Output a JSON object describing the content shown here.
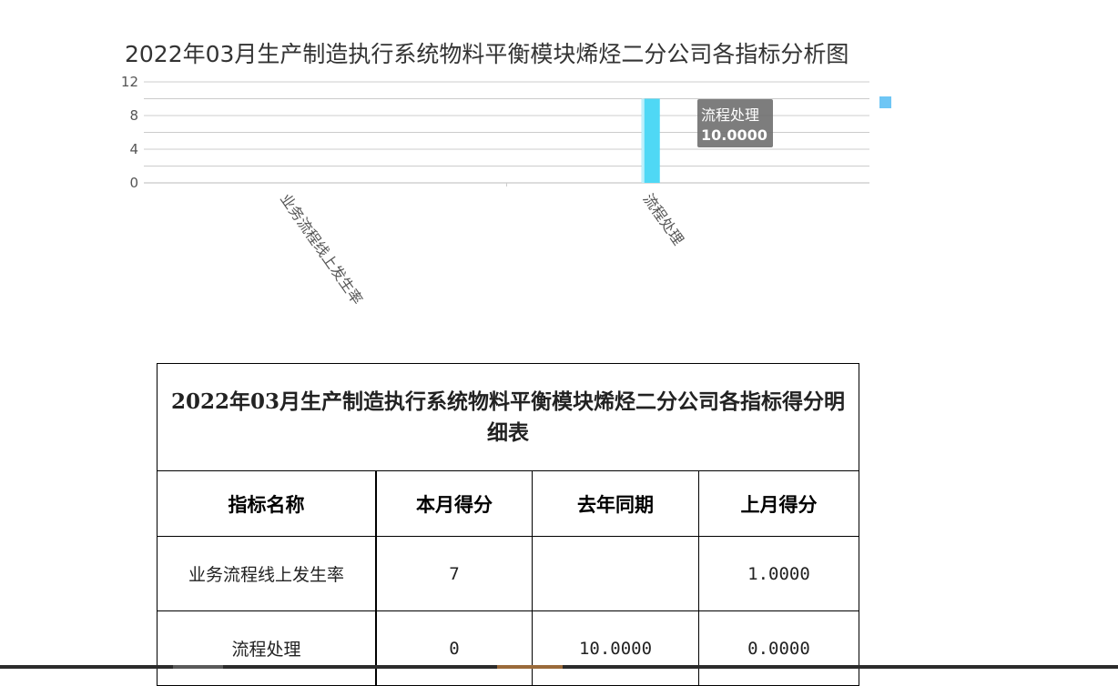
{
  "chart_data": {
    "type": "bar",
    "title": "2022年03月生产制造执行系统物料平衡模块烯烃二分公司各指标分析图",
    "categories": [
      "业务流程线上发生率",
      "流程处理"
    ],
    "series": [
      {
        "values": [
          0,
          10.0
        ],
        "color": "#4fd8f5"
      }
    ],
    "ylim": [
      0,
      12
    ],
    "yticks": [
      "0",
      "4",
      "8",
      "12"
    ],
    "grid": true,
    "legend_position": "top-right",
    "legend_color": "#6ec6f5",
    "tooltip": {
      "label": "流程处理",
      "value": "10.0000"
    }
  },
  "table": {
    "title": "2022年03月生产制造执行系统物料平衡模块烯烃二分公司各指标得分明细表",
    "headers": [
      "指标名称",
      "本月得分",
      "去年同期",
      "上月得分"
    ],
    "rows": [
      [
        "业务流程线上发生率",
        "7",
        "",
        "1.0000"
      ],
      [
        "流程处理",
        "0",
        "10.0000",
        "0.0000"
      ]
    ]
  }
}
